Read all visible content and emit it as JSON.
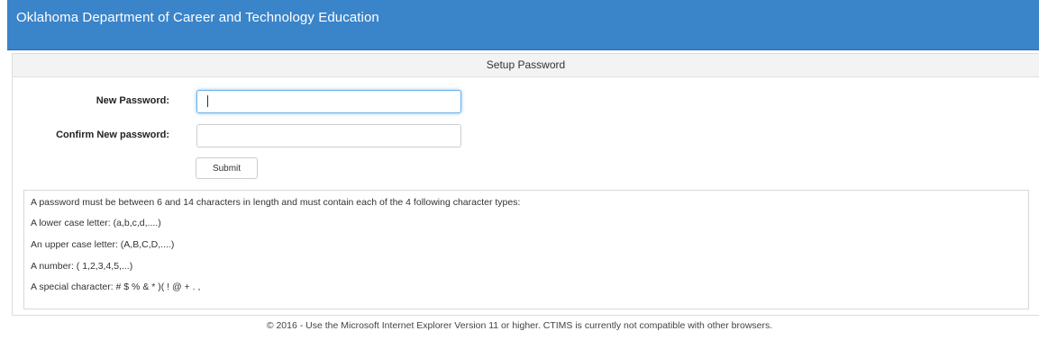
{
  "header": {
    "title": "Oklahoma Department of Career and Technology Education",
    "background_color": "#3a84c9"
  },
  "panel": {
    "title": "Setup Password"
  },
  "form": {
    "new_password_label": "New Password:",
    "new_password_value": "",
    "confirm_password_label": "Confirm New password:",
    "confirm_password_value": "",
    "submit_label": "Submit"
  },
  "rules": {
    "intro": "A password must be between 6 and 14 characters in length and must contain each of the 4 following character types:",
    "items": [
      "A lower case letter: (a,b,c,d,....)",
      "An upper case letter: (A,B,C,D,....)",
      "A number: ( 1,2,3,4,5,...)",
      "A special character: # $ % & * )( ! @ + . ,"
    ]
  },
  "footer": {
    "text": "© 2016 - Use the Microsoft Internet Explorer Version 11 or higher. CTIMS is currently not compatible with other browsers."
  }
}
